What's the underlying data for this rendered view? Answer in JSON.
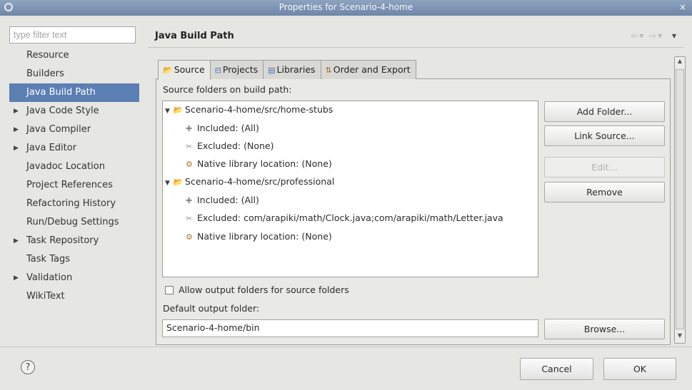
{
  "window": {
    "title": "Properties for Scenario-4-home",
    "close_label": "×"
  },
  "filter": {
    "placeholder": "type filter text",
    "value": ""
  },
  "nav": {
    "items": [
      {
        "label": "Resource",
        "expandable": false
      },
      {
        "label": "Builders",
        "expandable": false
      },
      {
        "label": "Java Build Path",
        "expandable": false,
        "selected": true
      },
      {
        "label": "Java Code Style",
        "expandable": true
      },
      {
        "label": "Java Compiler",
        "expandable": true
      },
      {
        "label": "Java Editor",
        "expandable": true
      },
      {
        "label": "Javadoc Location",
        "expandable": false
      },
      {
        "label": "Project References",
        "expandable": false
      },
      {
        "label": "Refactoring History",
        "expandable": false
      },
      {
        "label": "Run/Debug Settings",
        "expandable": false
      },
      {
        "label": "Task Repository",
        "expandable": true
      },
      {
        "label": "Task Tags",
        "expandable": false
      },
      {
        "label": "Validation",
        "expandable": true
      },
      {
        "label": "WikiText",
        "expandable": false
      }
    ]
  },
  "header": {
    "title": "Java Build Path",
    "back_arrow": "⇦▾",
    "forward_arrow": "⇨▾",
    "menu": "▾"
  },
  "tabs": [
    {
      "label": "Source",
      "active": true
    },
    {
      "label": "Projects",
      "active": false
    },
    {
      "label": "Libraries",
      "active": false
    },
    {
      "label": "Order and Export",
      "active": false
    }
  ],
  "source": {
    "section_label": "Source folders on build path:",
    "tree": [
      {
        "label": "Scenario-4-home/src/home-stubs"
      },
      {
        "label": "Included: (All)"
      },
      {
        "label": "Excluded: (None)"
      },
      {
        "label": "Native library location: (None)"
      },
      {
        "label": "Scenario-4-home/src/professional"
      },
      {
        "label": "Included: (All)"
      },
      {
        "label": "Excluded: com/arapiki/math/Clock.java;com/arapiki/math/Letter.java"
      },
      {
        "label": "Native library location: (None)"
      }
    ],
    "buttons": {
      "add_folder": "Add Folder...",
      "link_source": "Link Source...",
      "edit": "Edit...",
      "remove": "Remove"
    },
    "allow_output_label": "Allow output folders for source folders",
    "allow_output_checked": false,
    "default_output_label": "Default output folder:",
    "default_output_value": "Scenario-4-home/bin",
    "browse": "Browse..."
  },
  "footer": {
    "help": "?",
    "cancel": "Cancel",
    "ok": "OK"
  }
}
